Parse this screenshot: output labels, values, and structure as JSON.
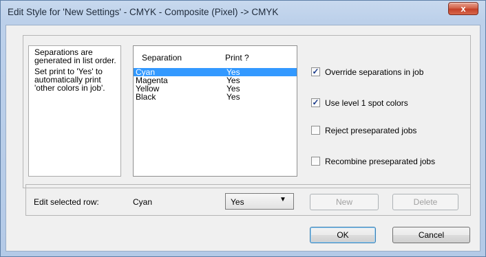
{
  "window": {
    "title": "Edit Style for 'New Settings' - CMYK - Composite (Pixel) -> CMYK",
    "close_glyph": "x"
  },
  "info": {
    "line1": "Separations are generated in list order.",
    "line2": "Set print to 'Yes' to automatically print 'other colors in job'."
  },
  "list": {
    "columns": [
      "Separation",
      "Print ?"
    ],
    "rows": [
      {
        "separation": "Cyan",
        "print": "Yes",
        "selected": true
      },
      {
        "separation": "Magenta",
        "print": "Yes",
        "selected": false
      },
      {
        "separation": "Yellow",
        "print": "Yes",
        "selected": false
      },
      {
        "separation": "Black",
        "print": "Yes",
        "selected": false
      }
    ]
  },
  "options": [
    {
      "label": "Override separations in job",
      "checked": true
    },
    {
      "label": "Use level 1 spot colors",
      "checked": true
    },
    {
      "label": "Reject preseparated jobs",
      "checked": false
    },
    {
      "label": "Recombine preseparated jobs",
      "checked": false
    }
  ],
  "edit_row": {
    "label": "Edit selected row:",
    "value": "Cyan",
    "print_select": "Yes",
    "new_label": "New",
    "delete_label": "Delete"
  },
  "buttons": {
    "ok": "OK",
    "cancel": "Cancel"
  },
  "colors": {
    "selection": "#3399ff",
    "close_button": "#c54129"
  }
}
